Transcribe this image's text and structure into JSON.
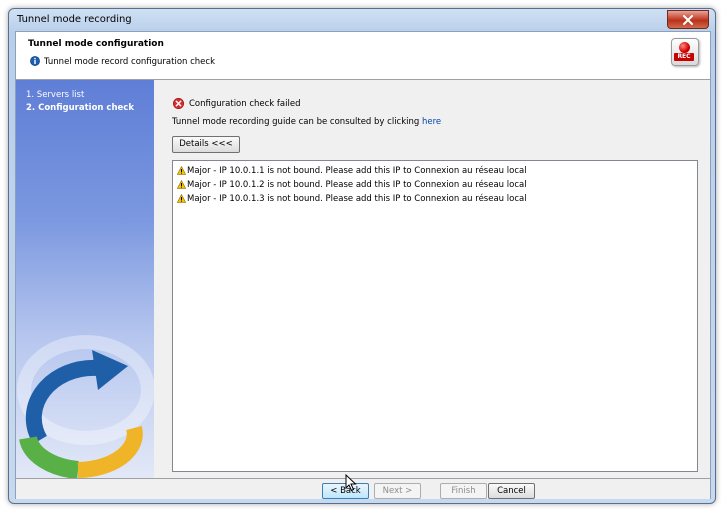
{
  "window": {
    "title": "Tunnel mode recording"
  },
  "header": {
    "title": "Tunnel mode configuration",
    "subtitle": "Tunnel mode record configuration check",
    "rec_badge": "REC"
  },
  "sidebar": {
    "steps": [
      {
        "label": "1. Servers list"
      },
      {
        "label": "2. Configuration check",
        "active": true
      }
    ]
  },
  "main": {
    "status": "Configuration check failed",
    "guide_text": "Tunnel mode recording guide can be consulted by clicking ",
    "guide_link": "here",
    "details_button": "Details <<<",
    "messages": [
      "Major - IP 10.0.1.1 is not bound. Please add this IP to Connexion au réseau local",
      "Major - IP 10.0.1.2 is not bound. Please add this IP to Connexion au réseau local",
      "Major - IP 10.0.1.3 is not bound. Please add this IP to Connexion au réseau local"
    ]
  },
  "footer": {
    "back": "< Back",
    "next": "Next >",
    "finish": "Finish",
    "cancel": "Cancel"
  },
  "colors": {
    "sidebar_top": "#5f7ed6",
    "link": "#0645ad",
    "error_icon": "#d32f2f",
    "warning_icon": "#f5c400",
    "logo_blue": "#1f5fa8",
    "logo_green": "#58b047",
    "logo_yellow": "#f0b429"
  },
  "icons": {
    "close": "close-icon",
    "info": "info-icon",
    "record": "record-icon",
    "error": "error-icon",
    "warning": "warning-icon",
    "logo": "refresh-arrow-logo"
  }
}
